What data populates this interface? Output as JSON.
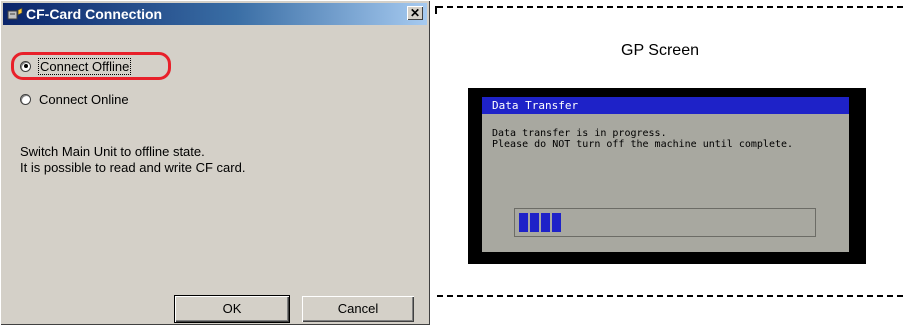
{
  "dialog": {
    "title": "CF-Card Connection",
    "close_label": "✕",
    "options": [
      {
        "label": "Connect Offline",
        "selected": true
      },
      {
        "label": "Connect Online",
        "selected": false
      }
    ],
    "description": [
      "Switch Main Unit to offline state.",
      "It is possible to read and write CF card."
    ],
    "ok_label": "OK",
    "cancel_label": "Cancel",
    "highlight_color": "#e8202a"
  },
  "gp": {
    "label": "GP Screen",
    "title": "Data Transfer",
    "lines": [
      "Data transfer is in progress.",
      "Please do NOT turn off the machine until complete."
    ],
    "progress": 0.16,
    "bar_color": "#1e22c8"
  }
}
